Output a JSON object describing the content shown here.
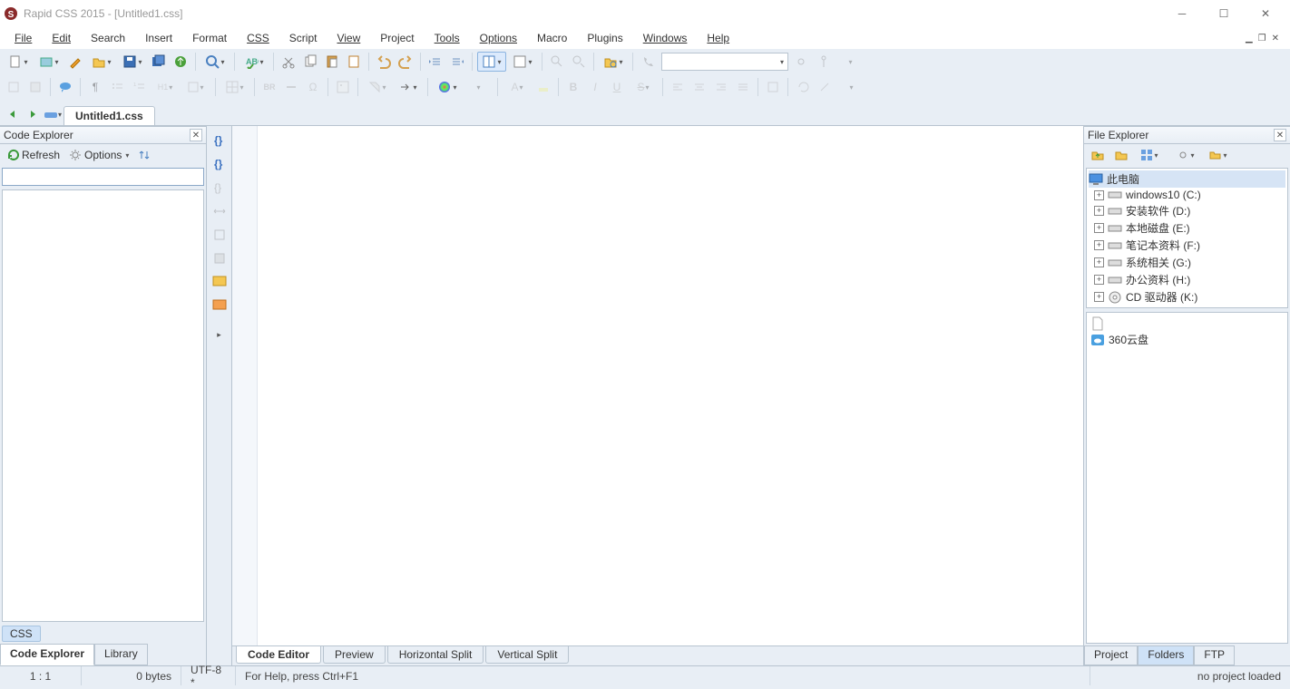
{
  "app": {
    "title": "Rapid CSS 2015 - [Untitled1.css]"
  },
  "menu": {
    "file": "File",
    "edit": "Edit",
    "search": "Search",
    "insert": "Insert",
    "format": "Format",
    "css": "CSS",
    "script": "Script",
    "view": "View",
    "project": "Project",
    "tools": "Tools",
    "options": "Options",
    "macro": "Macro",
    "plugins": "Plugins",
    "windows": "Windows",
    "help": "Help"
  },
  "tabs": {
    "doc1": "Untitled1.css"
  },
  "codeExplorer": {
    "title": "Code Explorer",
    "refresh": "Refresh",
    "options": "Options",
    "cssTag": "CSS",
    "tab_code": "Code Explorer",
    "tab_library": "Library"
  },
  "editor": {
    "tab_code": "Code Editor",
    "tab_preview": "Preview",
    "tab_hsplit": "Horizontal Split",
    "tab_vsplit": "Vertical Split"
  },
  "fileExplorer": {
    "title": "File Explorer",
    "root": "此电脑",
    "drives": [
      "windows10 (C:)",
      "安装软件 (D:)",
      "本地磁盘 (E:)",
      "笔记本资料 (F:)",
      "系统相关 (G:)",
      "办公资料 (H:)",
      "CD 驱动器 (K:)"
    ],
    "file1": "360云盘",
    "tab_project": "Project",
    "tab_folders": "Folders",
    "tab_ftp": "FTP"
  },
  "status": {
    "pos": "1 : 1",
    "size": "0 bytes",
    "encoding": "UTF-8 *",
    "help": "For Help, press Ctrl+F1",
    "project": "no project loaded"
  }
}
